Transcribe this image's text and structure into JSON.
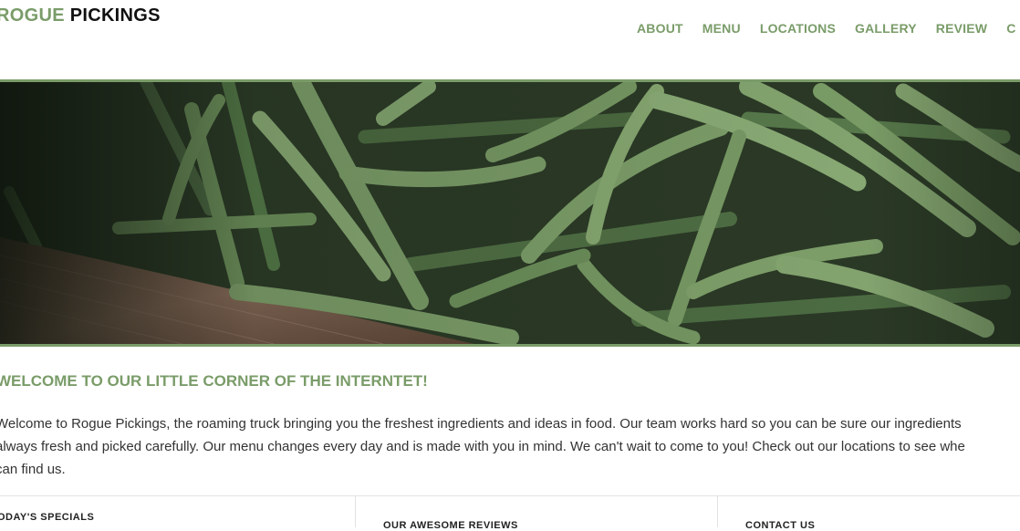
{
  "brand": {
    "word1": "ROGUE",
    "word2": "PICKINGS"
  },
  "nav": {
    "items": [
      "ABOUT",
      "MENU",
      "LOCATIONS",
      "GALLERY",
      "REVIEW",
      "C"
    ]
  },
  "hero": {
    "alt": "Fresh green beans piled in a wooden crate"
  },
  "welcome": {
    "title": "WELCOME TO OUR LITTLE CORNER OF THE INTERNTET!",
    "lines": [
      "Welcome to Rogue Pickings, the roaming truck bringing you the freshest ingredients and ideas in food. Our team works hard so you can be sure our ingredients",
      "always fresh and picked carefully. Our menu changes every day and is made with you in mind. We can't wait to come to you! Check out our locations to see whe",
      "can find us."
    ]
  },
  "sections": {
    "specials": "ODAY'S SPECIALS",
    "reviews": "OUR AWESOME REVIEWS",
    "contact": "CONTACT US"
  },
  "colors": {
    "accent": "#7a9c69",
    "text": "#333333",
    "dark": "#111111"
  }
}
